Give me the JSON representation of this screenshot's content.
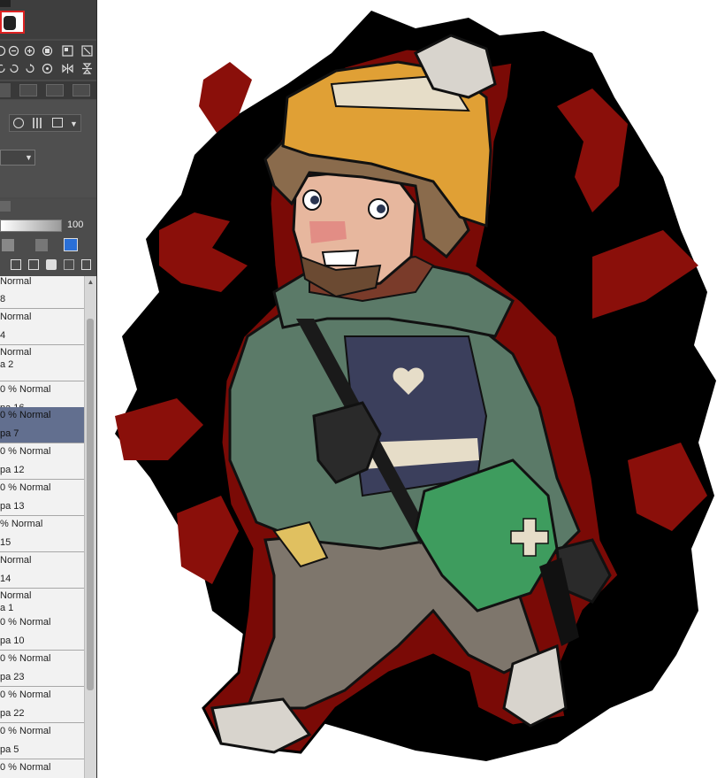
{
  "tool_panel": {
    "opacity_value": "100",
    "icons": [
      "rotate-left-icon",
      "rotate-right-icon",
      "zoom-in-icon",
      "stop-icon",
      "fit-icon",
      "flip-icon",
      "undo-rotate-icon",
      "redo-rotate-icon",
      "reset-icon",
      "mirror-icon",
      "flip-vertical-icon"
    ]
  },
  "layers": [
    {
      "mode": "Normal",
      "name": "8"
    },
    {
      "mode": "Normal",
      "name": "4"
    },
    {
      "mode": "Normal",
      "name": "a 2"
    },
    {
      "mode": "0 % Normal",
      "name": "pa 16"
    },
    {
      "mode": "0 % Normal",
      "name": "pa 7"
    },
    {
      "mode": "0 % Normal",
      "name": "pa 12"
    },
    {
      "mode": "0 % Normal",
      "name": "pa 13"
    },
    {
      "mode": "% Normal",
      "name": "15"
    },
    {
      "mode": "Normal",
      "name": "14"
    },
    {
      "mode": "Normal",
      "name": "a 1"
    },
    {
      "mode": "0 % Normal",
      "name": "pa 10"
    },
    {
      "mode": "0 % Normal",
      "name": "pa 23"
    },
    {
      "mode": "0 % Normal",
      "name": "pa 22"
    },
    {
      "mode": "0 % Normal",
      "name": "pa 5"
    },
    {
      "mode": "0 % Normal",
      "name": ""
    }
  ],
  "colors": {
    "panel": "#4a4a4a",
    "layer_bg": "#f2f2f2",
    "layer_selected": "#626f8f",
    "accent_red": "#8a0f0a",
    "jacket": "#5b7a68",
    "beanie": "#e0a035",
    "bag": "#3e9c5e"
  }
}
